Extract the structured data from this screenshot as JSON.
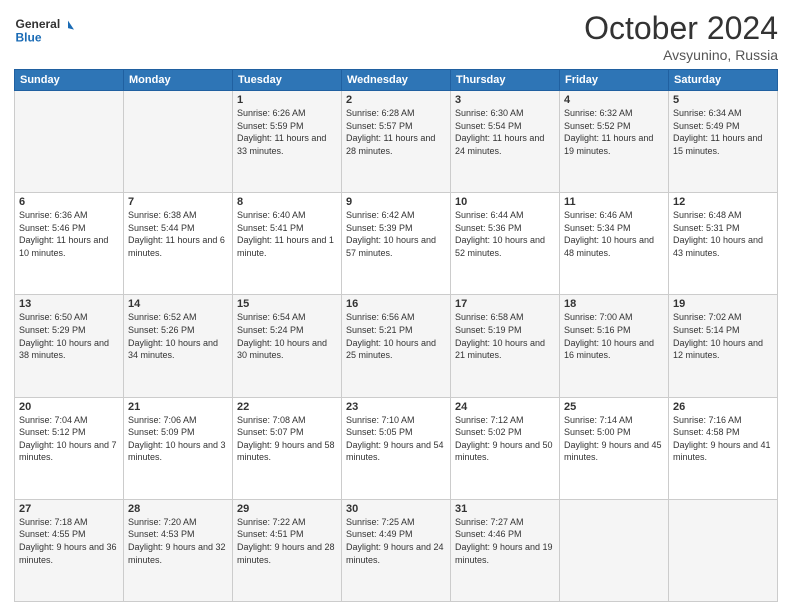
{
  "header": {
    "logo_text_general": "General",
    "logo_text_blue": "Blue",
    "month_title": "October 2024",
    "location": "Avsyunino, Russia"
  },
  "weekdays": [
    "Sunday",
    "Monday",
    "Tuesday",
    "Wednesday",
    "Thursday",
    "Friday",
    "Saturday"
  ],
  "weeks": [
    [
      {
        "day": "",
        "info": ""
      },
      {
        "day": "",
        "info": ""
      },
      {
        "day": "1",
        "info": "Sunrise: 6:26 AM\nSunset: 5:59 PM\nDaylight: 11 hours and 33 minutes."
      },
      {
        "day": "2",
        "info": "Sunrise: 6:28 AM\nSunset: 5:57 PM\nDaylight: 11 hours and 28 minutes."
      },
      {
        "day": "3",
        "info": "Sunrise: 6:30 AM\nSunset: 5:54 PM\nDaylight: 11 hours and 24 minutes."
      },
      {
        "day": "4",
        "info": "Sunrise: 6:32 AM\nSunset: 5:52 PM\nDaylight: 11 hours and 19 minutes."
      },
      {
        "day": "5",
        "info": "Sunrise: 6:34 AM\nSunset: 5:49 PM\nDaylight: 11 hours and 15 minutes."
      }
    ],
    [
      {
        "day": "6",
        "info": "Sunrise: 6:36 AM\nSunset: 5:46 PM\nDaylight: 11 hours and 10 minutes."
      },
      {
        "day": "7",
        "info": "Sunrise: 6:38 AM\nSunset: 5:44 PM\nDaylight: 11 hours and 6 minutes."
      },
      {
        "day": "8",
        "info": "Sunrise: 6:40 AM\nSunset: 5:41 PM\nDaylight: 11 hours and 1 minute."
      },
      {
        "day": "9",
        "info": "Sunrise: 6:42 AM\nSunset: 5:39 PM\nDaylight: 10 hours and 57 minutes."
      },
      {
        "day": "10",
        "info": "Sunrise: 6:44 AM\nSunset: 5:36 PM\nDaylight: 10 hours and 52 minutes."
      },
      {
        "day": "11",
        "info": "Sunrise: 6:46 AM\nSunset: 5:34 PM\nDaylight: 10 hours and 48 minutes."
      },
      {
        "day": "12",
        "info": "Sunrise: 6:48 AM\nSunset: 5:31 PM\nDaylight: 10 hours and 43 minutes."
      }
    ],
    [
      {
        "day": "13",
        "info": "Sunrise: 6:50 AM\nSunset: 5:29 PM\nDaylight: 10 hours and 38 minutes."
      },
      {
        "day": "14",
        "info": "Sunrise: 6:52 AM\nSunset: 5:26 PM\nDaylight: 10 hours and 34 minutes."
      },
      {
        "day": "15",
        "info": "Sunrise: 6:54 AM\nSunset: 5:24 PM\nDaylight: 10 hours and 30 minutes."
      },
      {
        "day": "16",
        "info": "Sunrise: 6:56 AM\nSunset: 5:21 PM\nDaylight: 10 hours and 25 minutes."
      },
      {
        "day": "17",
        "info": "Sunrise: 6:58 AM\nSunset: 5:19 PM\nDaylight: 10 hours and 21 minutes."
      },
      {
        "day": "18",
        "info": "Sunrise: 7:00 AM\nSunset: 5:16 PM\nDaylight: 10 hours and 16 minutes."
      },
      {
        "day": "19",
        "info": "Sunrise: 7:02 AM\nSunset: 5:14 PM\nDaylight: 10 hours and 12 minutes."
      }
    ],
    [
      {
        "day": "20",
        "info": "Sunrise: 7:04 AM\nSunset: 5:12 PM\nDaylight: 10 hours and 7 minutes."
      },
      {
        "day": "21",
        "info": "Sunrise: 7:06 AM\nSunset: 5:09 PM\nDaylight: 10 hours and 3 minutes."
      },
      {
        "day": "22",
        "info": "Sunrise: 7:08 AM\nSunset: 5:07 PM\nDaylight: 9 hours and 58 minutes."
      },
      {
        "day": "23",
        "info": "Sunrise: 7:10 AM\nSunset: 5:05 PM\nDaylight: 9 hours and 54 minutes."
      },
      {
        "day": "24",
        "info": "Sunrise: 7:12 AM\nSunset: 5:02 PM\nDaylight: 9 hours and 50 minutes."
      },
      {
        "day": "25",
        "info": "Sunrise: 7:14 AM\nSunset: 5:00 PM\nDaylight: 9 hours and 45 minutes."
      },
      {
        "day": "26",
        "info": "Sunrise: 7:16 AM\nSunset: 4:58 PM\nDaylight: 9 hours and 41 minutes."
      }
    ],
    [
      {
        "day": "27",
        "info": "Sunrise: 7:18 AM\nSunset: 4:55 PM\nDaylight: 9 hours and 36 minutes."
      },
      {
        "day": "28",
        "info": "Sunrise: 7:20 AM\nSunset: 4:53 PM\nDaylight: 9 hours and 32 minutes."
      },
      {
        "day": "29",
        "info": "Sunrise: 7:22 AM\nSunset: 4:51 PM\nDaylight: 9 hours and 28 minutes."
      },
      {
        "day": "30",
        "info": "Sunrise: 7:25 AM\nSunset: 4:49 PM\nDaylight: 9 hours and 24 minutes."
      },
      {
        "day": "31",
        "info": "Sunrise: 7:27 AM\nSunset: 4:46 PM\nDaylight: 9 hours and 19 minutes."
      },
      {
        "day": "",
        "info": ""
      },
      {
        "day": "",
        "info": ""
      }
    ]
  ]
}
